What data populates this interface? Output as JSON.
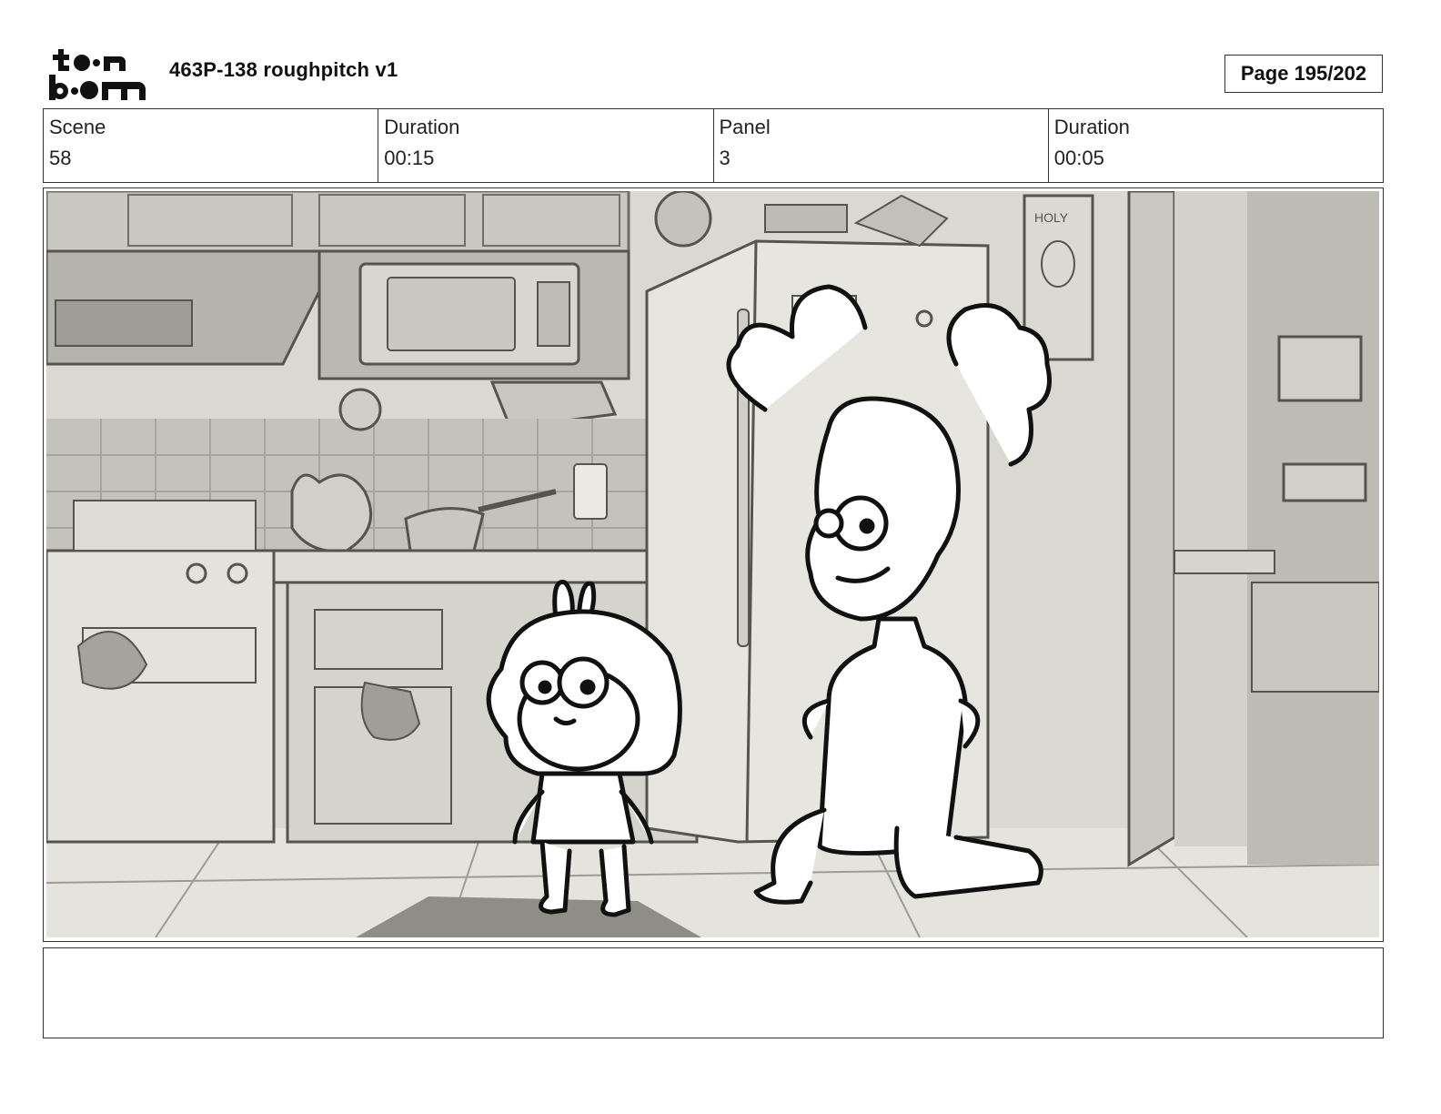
{
  "header": {
    "logo_top": "to•n",
    "logo_bottom": "b••m",
    "title": "463P-138 roughpitch v1",
    "page": "Page 195/202"
  },
  "info": {
    "scene_label": "Scene",
    "scene_value": "58",
    "scene_duration_label": "Duration",
    "scene_duration_value": "00:15",
    "panel_label": "Panel",
    "panel_value": "3",
    "panel_duration_label": "Duration",
    "panel_duration_value": "00:05"
  },
  "panel": {
    "poster_text": "HOLY"
  },
  "notes": {
    "text": ""
  }
}
